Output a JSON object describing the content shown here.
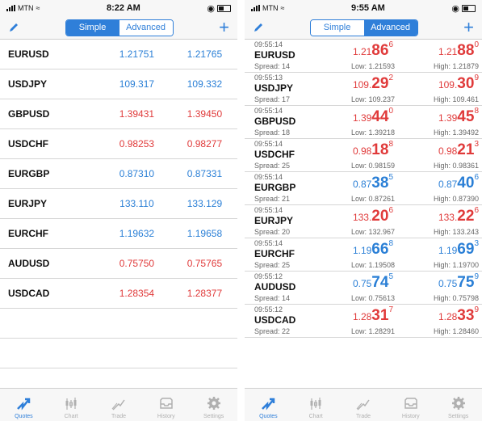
{
  "left": {
    "status": {
      "carrier": "MTN",
      "time": "8:22 AM"
    },
    "toolbar": {
      "segments": [
        "Simple",
        "Advanced"
      ],
      "active": "Simple"
    },
    "quotes": [
      {
        "symbol": "EURUSD",
        "bid": "1.21751",
        "ask": "1.21765",
        "color": "blue"
      },
      {
        "symbol": "USDJPY",
        "bid": "109.317",
        "ask": "109.332",
        "color": "blue"
      },
      {
        "symbol": "GBPUSD",
        "bid": "1.39431",
        "ask": "1.39450",
        "color": "red"
      },
      {
        "symbol": "USDCHF",
        "bid": "0.98253",
        "ask": "0.98277",
        "color": "red"
      },
      {
        "symbol": "EURGBP",
        "bid": "0.87310",
        "ask": "0.87331",
        "color": "blue"
      },
      {
        "symbol": "EURJPY",
        "bid": "133.110",
        "ask": "133.129",
        "color": "blue"
      },
      {
        "symbol": "EURCHF",
        "bid": "1.19632",
        "ask": "1.19658",
        "color": "blue"
      },
      {
        "symbol": "AUDUSD",
        "bid": "0.75750",
        "ask": "0.75765",
        "color": "red"
      },
      {
        "symbol": "USDCAD",
        "bid": "1.28354",
        "ask": "1.28377",
        "color": "red"
      }
    ],
    "tabs": [
      {
        "label": "Quotes",
        "icon": "quotes-icon"
      },
      {
        "label": "Chart",
        "icon": "chart-icon"
      },
      {
        "label": "Trade",
        "icon": "trade-icon"
      },
      {
        "label": "History",
        "icon": "history-icon"
      },
      {
        "label": "Settings",
        "icon": "settings-icon"
      }
    ],
    "active_tab": "Quotes"
  },
  "right": {
    "status": {
      "carrier": "MTN",
      "time": "9:55 AM"
    },
    "toolbar": {
      "segments": [
        "Simple",
        "Advanced"
      ],
      "active": "Advanced"
    },
    "quotes": [
      {
        "time": "09:55:14",
        "symbol": "EURUSD",
        "spread": "Spread: 14",
        "bid": [
          "1.21",
          "86",
          "6"
        ],
        "ask": [
          "1.21",
          "88",
          "0"
        ],
        "low": "Low: 1.21593",
        "high": "High: 1.21879",
        "color": "red"
      },
      {
        "time": "09:55:13",
        "symbol": "USDJPY",
        "spread": "Spread: 17",
        "bid": [
          "109.",
          "29",
          "2"
        ],
        "ask": [
          "109.",
          "30",
          "9"
        ],
        "low": "Low: 109.237",
        "high": "High: 109.461",
        "color": "red"
      },
      {
        "time": "09:55:14",
        "symbol": "GBPUSD",
        "spread": "Spread: 18",
        "bid": [
          "1.39",
          "44",
          "0"
        ],
        "ask": [
          "1.39",
          "45",
          "8"
        ],
        "low": "Low: 1.39218",
        "high": "High: 1.39492",
        "color": "red"
      },
      {
        "time": "09:55:14",
        "symbol": "USDCHF",
        "spread": "Spread: 25",
        "bid": [
          "0.98",
          "18",
          "8"
        ],
        "ask": [
          "0.98",
          "21",
          "3"
        ],
        "low": "Low: 0.98159",
        "high": "High: 0.98361",
        "color": "red"
      },
      {
        "time": "09:55:14",
        "symbol": "EURGBP",
        "spread": "Spread: 21",
        "bid": [
          "0.87",
          "38",
          "5"
        ],
        "ask": [
          "0.87",
          "40",
          "6"
        ],
        "low": "Low: 0.87261",
        "high": "High: 0.87390",
        "color": "blue"
      },
      {
        "time": "09:55:14",
        "symbol": "EURJPY",
        "spread": "Spread: 20",
        "bid": [
          "133.",
          "20",
          "6"
        ],
        "ask": [
          "133.",
          "22",
          "6"
        ],
        "low": "Low: 132.967",
        "high": "High: 133.243",
        "color": "red"
      },
      {
        "time": "09:55:14",
        "symbol": "EURCHF",
        "spread": "Spread: 25",
        "bid": [
          "1.19",
          "66",
          "8"
        ],
        "ask": [
          "1.19",
          "69",
          "3"
        ],
        "low": "Low: 1.19508",
        "high": "High: 1.19700",
        "color": "blue"
      },
      {
        "time": "09:55:12",
        "symbol": "AUDUSD",
        "spread": "Spread: 14",
        "bid": [
          "0.75",
          "74",
          "5"
        ],
        "ask": [
          "0.75",
          "75",
          "9"
        ],
        "low": "Low: 0.75613",
        "high": "High: 0.75798",
        "color": "blue"
      },
      {
        "time": "09:55:12",
        "symbol": "USDCAD",
        "spread": "Spread: 22",
        "bid": [
          "1.28",
          "31",
          "7"
        ],
        "ask": [
          "1.28",
          "33",
          "9"
        ],
        "low": "Low: 1.28291",
        "high": "High: 1.28460",
        "color": "red"
      }
    ],
    "tabs": [
      {
        "label": "Quotes",
        "icon": "quotes-icon"
      },
      {
        "label": "Chart",
        "icon": "chart-icon"
      },
      {
        "label": "Trade",
        "icon": "trade-icon"
      },
      {
        "label": "History",
        "icon": "history-icon"
      },
      {
        "label": "Settings",
        "icon": "settings-icon"
      }
    ],
    "active_tab": "Quotes"
  },
  "colors": {
    "accent": "#2f7fd9",
    "up": "#2a7fd6",
    "down": "#e03a3a"
  }
}
